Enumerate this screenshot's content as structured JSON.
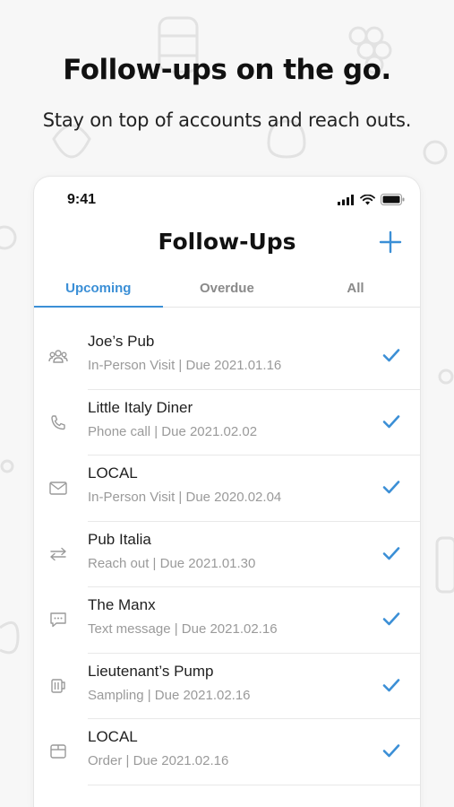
{
  "promo": {
    "headline": "Follow-ups on the go.",
    "subheadline": "Stay on top of accounts and reach outs."
  },
  "status_bar": {
    "time": "9:41"
  },
  "header": {
    "title": "Follow-Ups",
    "add_icon": "plus-icon"
  },
  "tabs": [
    {
      "label": "Upcoming",
      "active": true
    },
    {
      "label": "Overdue",
      "active": false
    },
    {
      "label": "All",
      "active": false
    }
  ],
  "followups": [
    {
      "name": "Joe’s Pub",
      "detail": "In-Person Visit | Due 2021.01.16",
      "icon": "people-icon"
    },
    {
      "name": "Little Italy Diner",
      "detail": "Phone call | Due 2021.02.02",
      "icon": "phone-icon"
    },
    {
      "name": "LOCAL",
      "detail": "In-Person Visit | Due 2020.02.04",
      "icon": "envelope-icon"
    },
    {
      "name": "Pub Italia",
      "detail": "Reach out | Due 2021.01.30",
      "icon": "arrows-icon"
    },
    {
      "name": "The Manx",
      "detail": "Text message | Due 2021.02.16",
      "icon": "chat-icon"
    },
    {
      "name": "Lieutenant’s Pump",
      "detail": "Sampling | Due 2021.02.16",
      "icon": "mug-icon"
    },
    {
      "name": "LOCAL",
      "detail": "Order | Due 2021.02.16",
      "icon": "box-icon"
    }
  ],
  "colors": {
    "accent": "#3b8fd6",
    "muted_text": "#9a9a9a",
    "background": "#f7f7f7"
  }
}
